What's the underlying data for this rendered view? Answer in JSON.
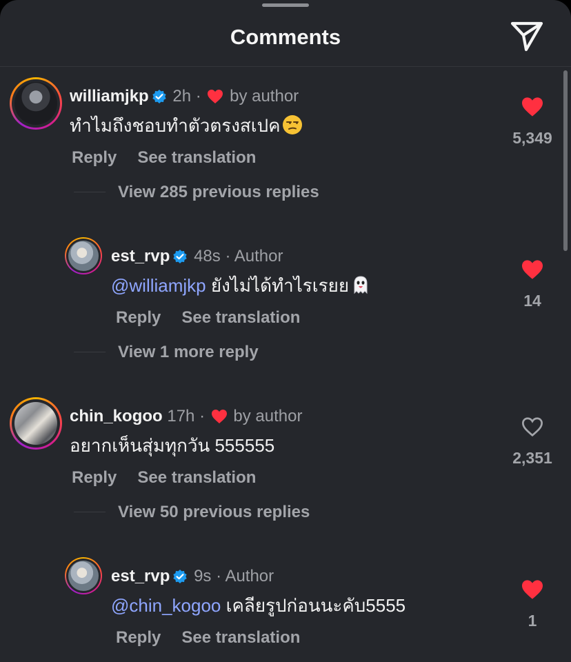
{
  "header": {
    "title": "Comments",
    "share_icon": "paper-plane-icon"
  },
  "colors": {
    "background": "#25272c",
    "like_red": "#ff3040",
    "mention": "#8fa6ff",
    "verified_blue": "#1d9bf0"
  },
  "comments": [
    {
      "username": "williamjkp",
      "verified": true,
      "time": "2h",
      "dot": "·",
      "author_label": "by author",
      "liked_by_author": true,
      "text": "ทำไมถึงชอบทำตัวตรงสเปค",
      "emoji": "unamused-face",
      "reply_label": "Reply",
      "translation_label": "See translation",
      "liked": true,
      "likes": "5,349",
      "view_replies": "View 285 previous replies"
    },
    {
      "username": "est_rvp",
      "verified": true,
      "time": "48s",
      "dot": "·",
      "author_label": "Author",
      "mention": "@williamjkp",
      "text": " ยังไม่ได้ทำไรเรยย",
      "emoji": "ghost",
      "reply_label": "Reply",
      "translation_label": "See translation",
      "liked": true,
      "likes": "14",
      "view_replies": "View 1 more reply"
    },
    {
      "username": "chin_kogoo",
      "verified": false,
      "time": "17h",
      "dot": "·",
      "author_label": "by author",
      "liked_by_author": true,
      "text": "อยากเห็นสุ่มทุกวัน 555555",
      "reply_label": "Reply",
      "translation_label": "See translation",
      "liked": false,
      "likes": "2,351",
      "view_replies": "View 50 previous replies"
    },
    {
      "username": "est_rvp",
      "verified": true,
      "time": "9s",
      "dot": "·",
      "author_label": "Author",
      "mention": "@chin_kogoo",
      "text": " เคลียรูปก่อนนะคับ5555",
      "reply_label": "Reply",
      "translation_label": "See translation",
      "liked": true,
      "likes": "1"
    }
  ]
}
